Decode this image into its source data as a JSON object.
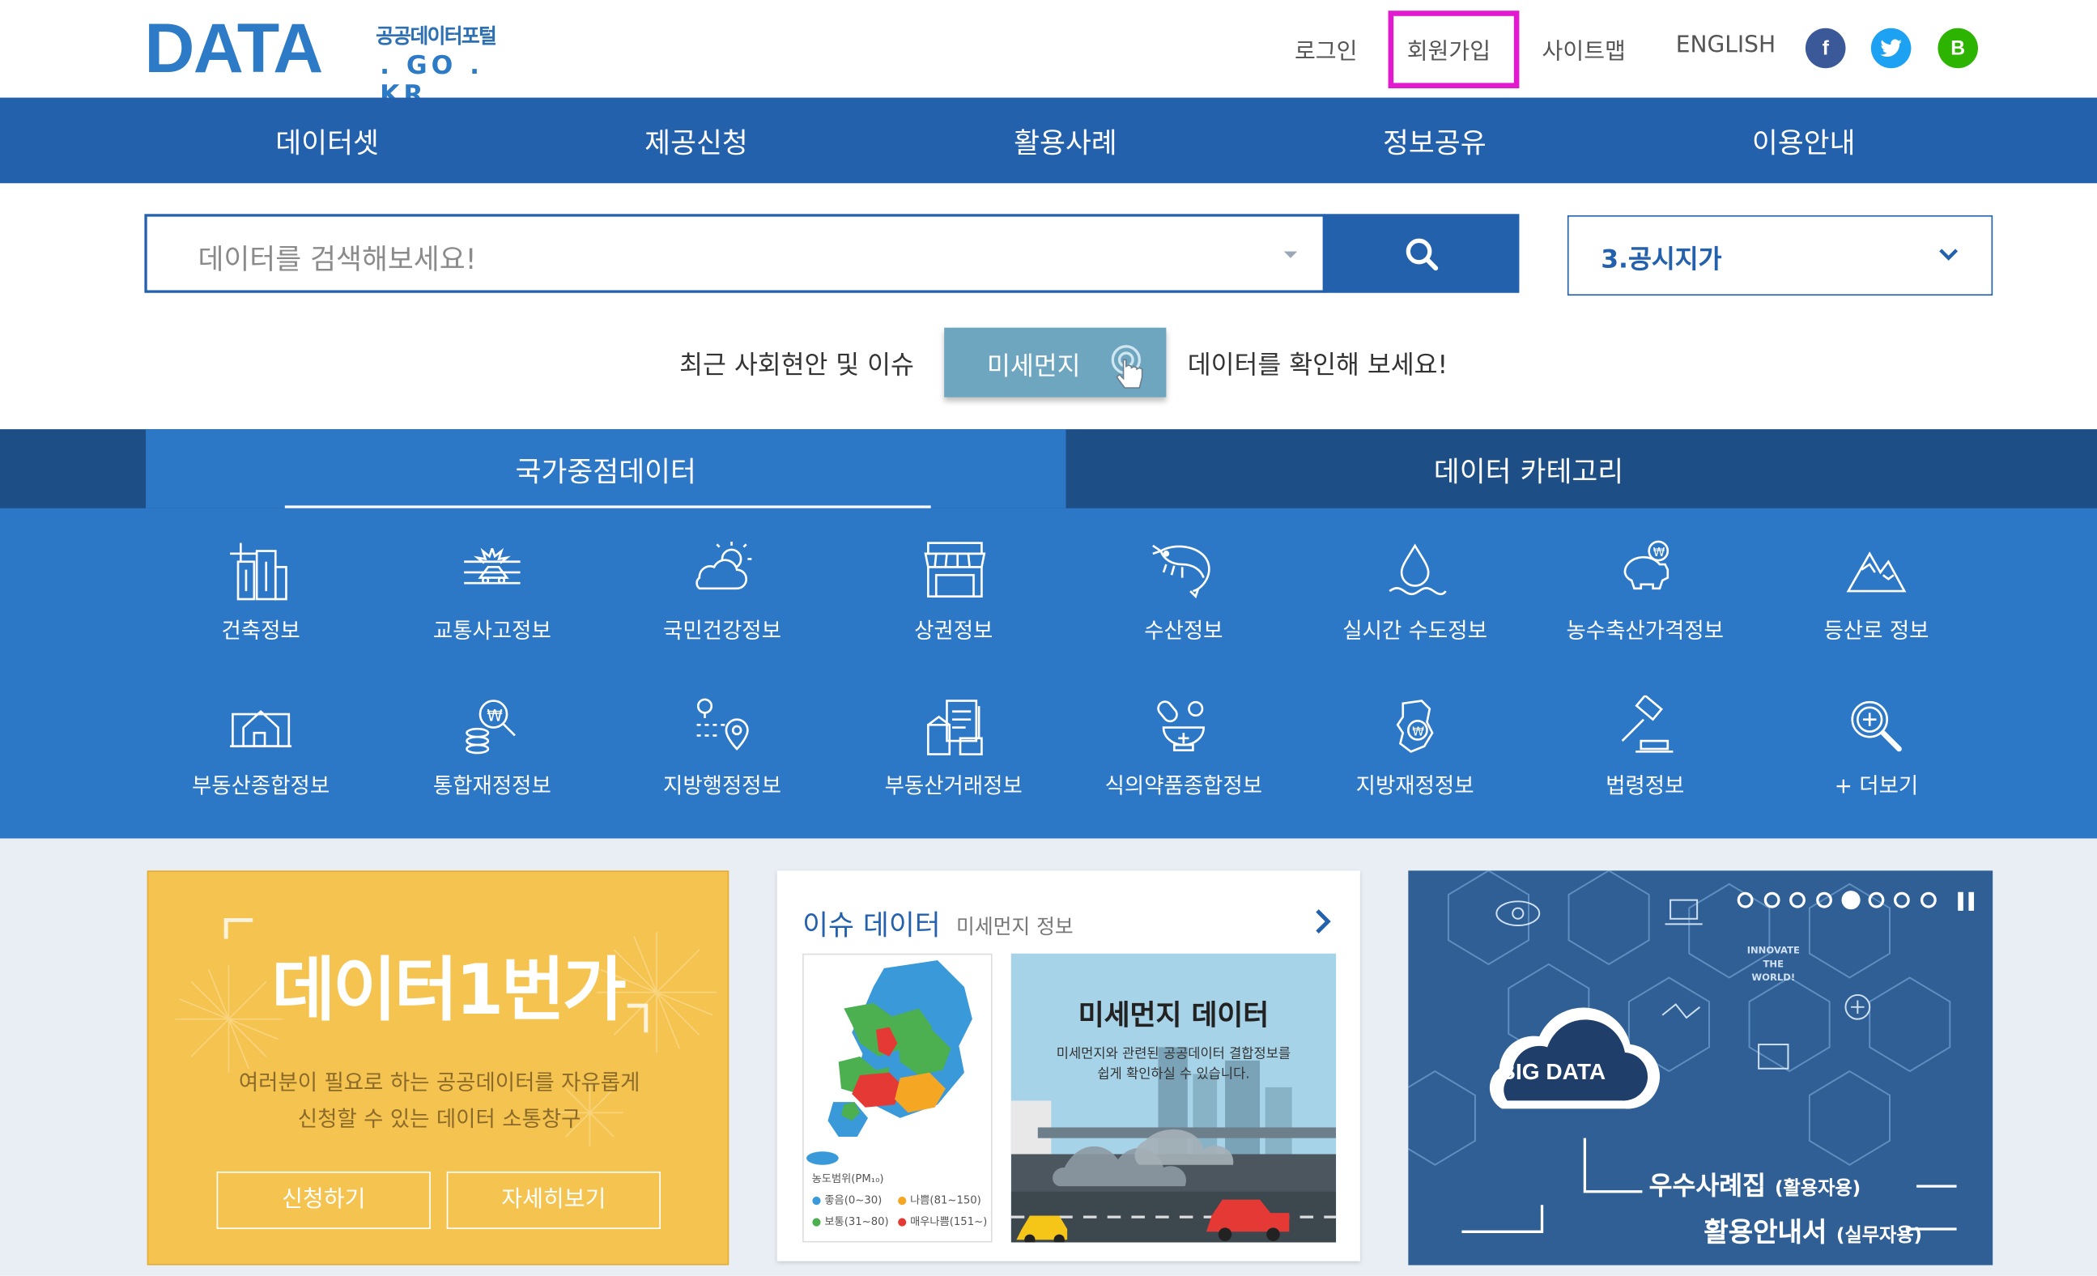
{
  "header": {
    "logo_word": "DATA",
    "logo_sub": "공공데이터포털",
    "logo_domain": ". GO . KR",
    "links": {
      "login": "로그인",
      "join": "회원가입",
      "sitemap": "사이트맵",
      "english": "ENGLISH"
    },
    "social": {
      "facebook": "f",
      "twitter": "t",
      "blog": "B"
    }
  },
  "nav": [
    "데이터셋",
    "제공신청",
    "활용사례",
    "정보공유",
    "이용안내"
  ],
  "search": {
    "placeholder": "데이터를 검색해보세요!",
    "select_value": "3.공시지가"
  },
  "issue": {
    "prefix": "최근 사회현안 및 이슈",
    "button": "미세먼지",
    "suffix": "데이터를 확인해 보세요!"
  },
  "tabs": {
    "active": "국가중점데이터",
    "inactive": "데이터 카테고리"
  },
  "categories": [
    {
      "label": "건축정보",
      "icon": "building-icon"
    },
    {
      "label": "교통사고정보",
      "icon": "traffic-accident-icon"
    },
    {
      "label": "국민건강정보",
      "icon": "weather-health-icon"
    },
    {
      "label": "상권정보",
      "icon": "store-icon"
    },
    {
      "label": "수산정보",
      "icon": "shrimp-icon"
    },
    {
      "label": "실시간 수도정보",
      "icon": "water-drop-icon"
    },
    {
      "label": "농수축산가격정보",
      "icon": "piggy-bank-icon"
    },
    {
      "label": "등산로 정보",
      "icon": "mountain-icon"
    },
    {
      "label": "부동산종합정보",
      "icon": "house-icon"
    },
    {
      "label": "통합재정정보",
      "icon": "finance-search-icon"
    },
    {
      "label": "지방행정정보",
      "icon": "location-route-icon"
    },
    {
      "label": "부동산거래정보",
      "icon": "real-estate-doc-icon"
    },
    {
      "label": "식의약품종합정보",
      "icon": "medicine-mortar-icon"
    },
    {
      "label": "지방재정정보",
      "icon": "region-money-icon"
    },
    {
      "label": "법령정보",
      "icon": "gavel-icon"
    },
    {
      "label": "+ 더보기",
      "icon": "zoom-plus-icon"
    }
  ],
  "cards": {
    "request": {
      "title": "데이터1번가",
      "desc1": "여러분이 필요로 하는 공공데이터를 자유롭게",
      "desc2": "신청할 수 있는 데이터 소통창구",
      "btn_apply": "신청하기",
      "btn_detail": "자세히보기"
    },
    "issue": {
      "heading": "이슈 데이터",
      "sub": "미세먼지 정보",
      "map_legend_title": "농도범위(PM₁₀)",
      "legend": [
        "좋음(0~30)",
        "나쁨(81~150)",
        "보통(31~80)",
        "매우나쁨(151~)"
      ],
      "image_title": "미세먼지 데이터",
      "image_desc1": "미세먼지와 관련된 공공데이터 결합정보를",
      "image_desc2": "쉽게 확인하실 수 있습니다."
    },
    "bigdata": {
      "cloud_label": "BIG DATA",
      "innovate": "INNOVATE THE WORLD!",
      "line1": "우수사례집",
      "line1_sub": "(활용자용)",
      "line2": "활용안내서",
      "line2_sub": "(실무자용)",
      "slide_count": 8,
      "active_slide": 5
    }
  },
  "colors": {
    "primary": "#2461ad",
    "band": "#2c78c7",
    "dark_band": "#1d4e86",
    "highlight": "#e11ad0",
    "issue_btn": "#6ea6c0",
    "yellow_card": "#f5c34f"
  }
}
